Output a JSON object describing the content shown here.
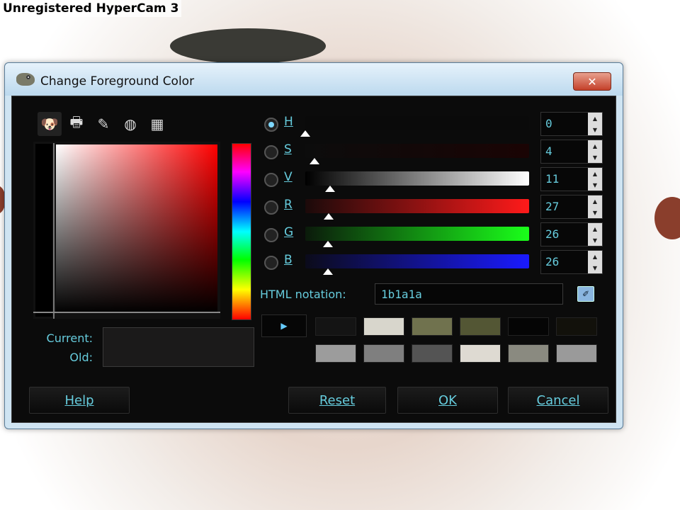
{
  "watermark": "Unregistered HyperCam 3",
  "window": {
    "title": "Change Foreground Color",
    "close_icon": "close-icon"
  },
  "selector_tabs": [
    {
      "icon": "gimp-icon",
      "glyph": "🐶",
      "active": true
    },
    {
      "icon": "printer-icon",
      "glyph": "🖶",
      "active": false
    },
    {
      "icon": "brush-icon",
      "glyph": "✎",
      "active": false
    },
    {
      "icon": "color-wheel-icon",
      "glyph": "◍",
      "active": false
    },
    {
      "icon": "palette-icon",
      "glyph": "▦",
      "active": false
    }
  ],
  "current_label": "Current:",
  "old_label": "Old:",
  "current_color": "#1b1a1a",
  "channels": [
    {
      "key": "H",
      "value": "0",
      "selected": true,
      "level": 0.0
    },
    {
      "key": "S",
      "value": "4",
      "selected": false,
      "level": 0.04
    },
    {
      "key": "V",
      "value": "11",
      "selected": false,
      "level": 0.11
    },
    {
      "key": "R",
      "value": "27",
      "selected": false,
      "level": 0.105
    },
    {
      "key": "G",
      "value": "26",
      "selected": false,
      "level": 0.102
    },
    {
      "key": "B",
      "value": "26",
      "selected": false,
      "level": 0.102
    }
  ],
  "html_notation_label": "HTML notation:",
  "html_value": "1b1a1a",
  "history_colors": [
    [
      "#141414",
      "#d8d6cc",
      "#70724e",
      "#535634",
      "#050505",
      "#12110b"
    ],
    [
      "#9c9c9c",
      "#7f7f7f",
      "#545454",
      "#dedad2",
      "#8a8a80",
      "#9a9a9a"
    ]
  ],
  "buttons": {
    "help": "Help",
    "reset": "Reset",
    "ok": "OK",
    "cancel": "Cancel"
  }
}
